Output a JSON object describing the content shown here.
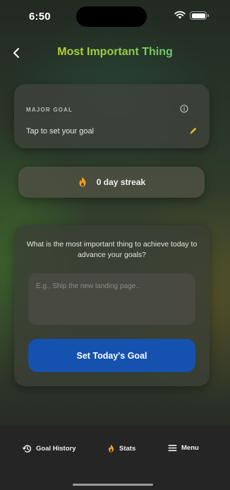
{
  "status_bar": {
    "time": "6:50"
  },
  "header": {
    "title": "Most Important Thing"
  },
  "goal_card": {
    "label": "MAJOR GOAL",
    "text": "Tap to set your goal"
  },
  "streak": {
    "text": "0 day streak"
  },
  "input_card": {
    "prompt": "What is the most important thing to achieve today to advance your goals?",
    "input_value": "",
    "input_placeholder": "E.g., Ship the new landing page..",
    "button_label": "Set Today's Goal"
  },
  "tab_bar": {
    "tabs": [
      {
        "label": "Goal History",
        "icon": "history-icon"
      },
      {
        "label": "Stats",
        "icon": "flame-icon"
      },
      {
        "label": "Menu",
        "icon": "menu-icon"
      }
    ]
  },
  "colors": {
    "accent_button": "#1552b0",
    "flame": "#f0a020",
    "edit_pencil": "#e5c22a",
    "title_gradient_start": "#d9d12a",
    "title_gradient_end": "#3fc7a0"
  }
}
